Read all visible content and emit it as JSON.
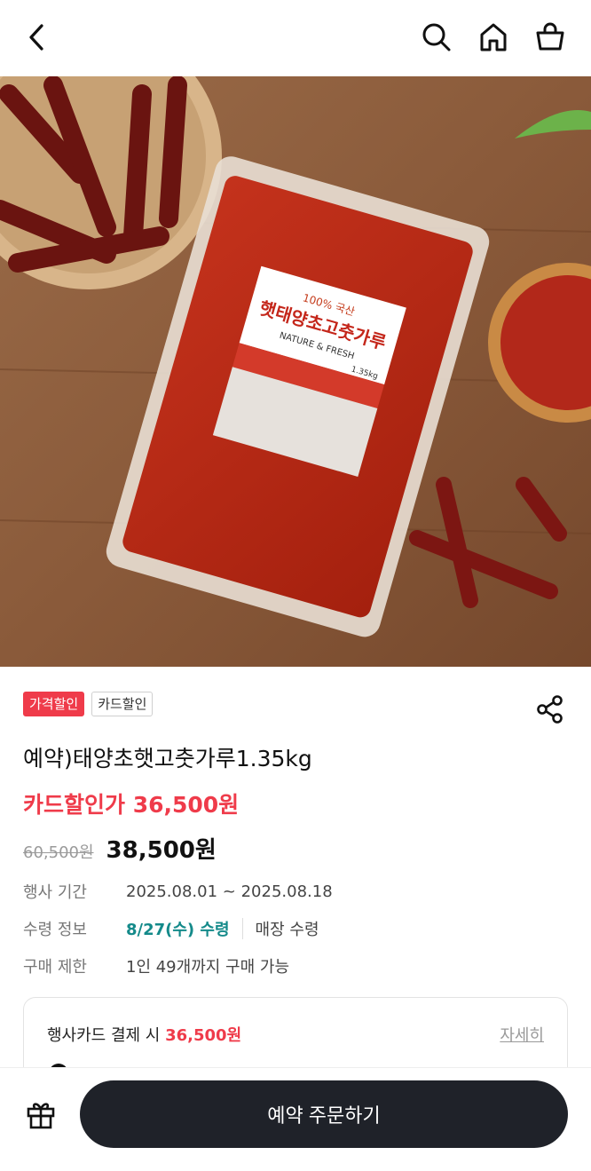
{
  "header": {
    "back_icon": "chevron-left-icon",
    "search_icon": "search-icon",
    "home_icon": "home-icon",
    "cart_icon": "shopping-basket-icon"
  },
  "product_image": {
    "package_line1": "100% 국산",
    "package_line2": "햇태양초고춧가루",
    "package_line3": "NATURE & FRESH",
    "package_weight": "1.35kg"
  },
  "badges": [
    "가격할인",
    "카드할인"
  ],
  "colors": {
    "accent_red": "#ef3b4a",
    "teal": "#148a8a",
    "button_dark": "#1f2229"
  },
  "product": {
    "title": "예약)태양초햇고춧가루1.35kg",
    "card_price": "카드할인가 36,500원",
    "original_price": "60,500원",
    "price": "38,500원"
  },
  "details": {
    "period_label": "행사 기간",
    "period_value": "2025.08.01 ~ 2025.08.18",
    "pickup_label": "수령 정보",
    "pickup_date": "8/27(수) 수령",
    "pickup_place": "매장 수령",
    "limit_label": "구매 제한",
    "limit_value": "1인 49개까지 구매 가능"
  },
  "card_box": {
    "text": "행사카드 결제 시",
    "price": "36,500원",
    "more": "자세히"
  },
  "bottom": {
    "gift_icon": "gift-icon",
    "order_label": "예약 주문하기"
  }
}
